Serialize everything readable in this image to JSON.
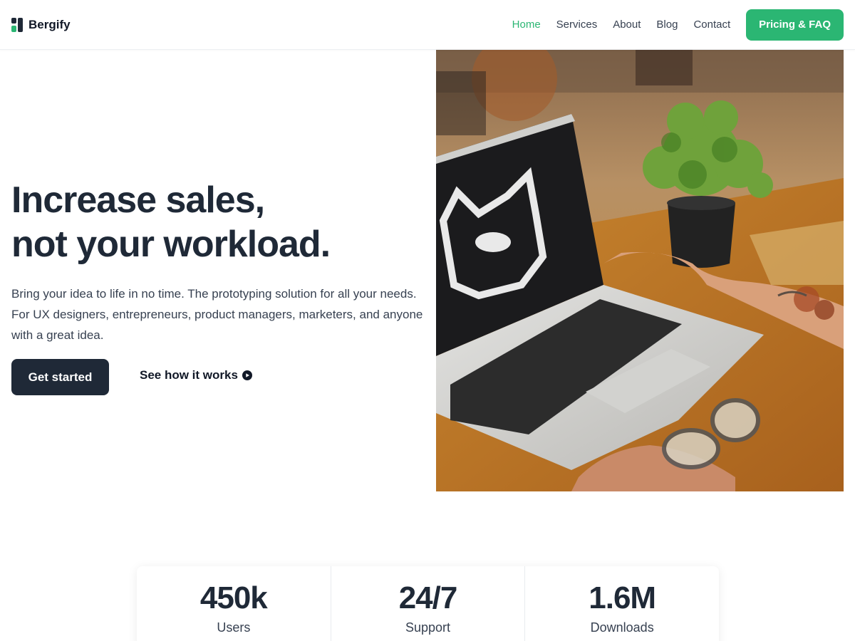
{
  "brand": {
    "name": "Bergify",
    "accent": "#2bb673",
    "dark": "#1f2937"
  },
  "nav": {
    "items": [
      {
        "label": "Home",
        "active": true
      },
      {
        "label": "Services"
      },
      {
        "label": "About"
      },
      {
        "label": "Blog"
      },
      {
        "label": "Contact"
      }
    ],
    "cta_label": "Pricing & FAQ"
  },
  "hero": {
    "title_line1": "Increase sales,",
    "title_line2": "not your workload.",
    "description": "Bring your idea to life in no time. The prototyping solution for all your needs. For UX designers, entrepreneurs, product managers, marketers, and anyone with a great idea.",
    "primary_button": "Get started",
    "secondary_link": "See how it works",
    "secondary_icon": "play-circle-icon",
    "image": "laptop-on-desk-with-plant-photo"
  },
  "stats": [
    {
      "value": "450k",
      "label": "Users"
    },
    {
      "value": "24/7",
      "label": "Support"
    },
    {
      "value": "1.6M",
      "label": "Downloads"
    }
  ]
}
